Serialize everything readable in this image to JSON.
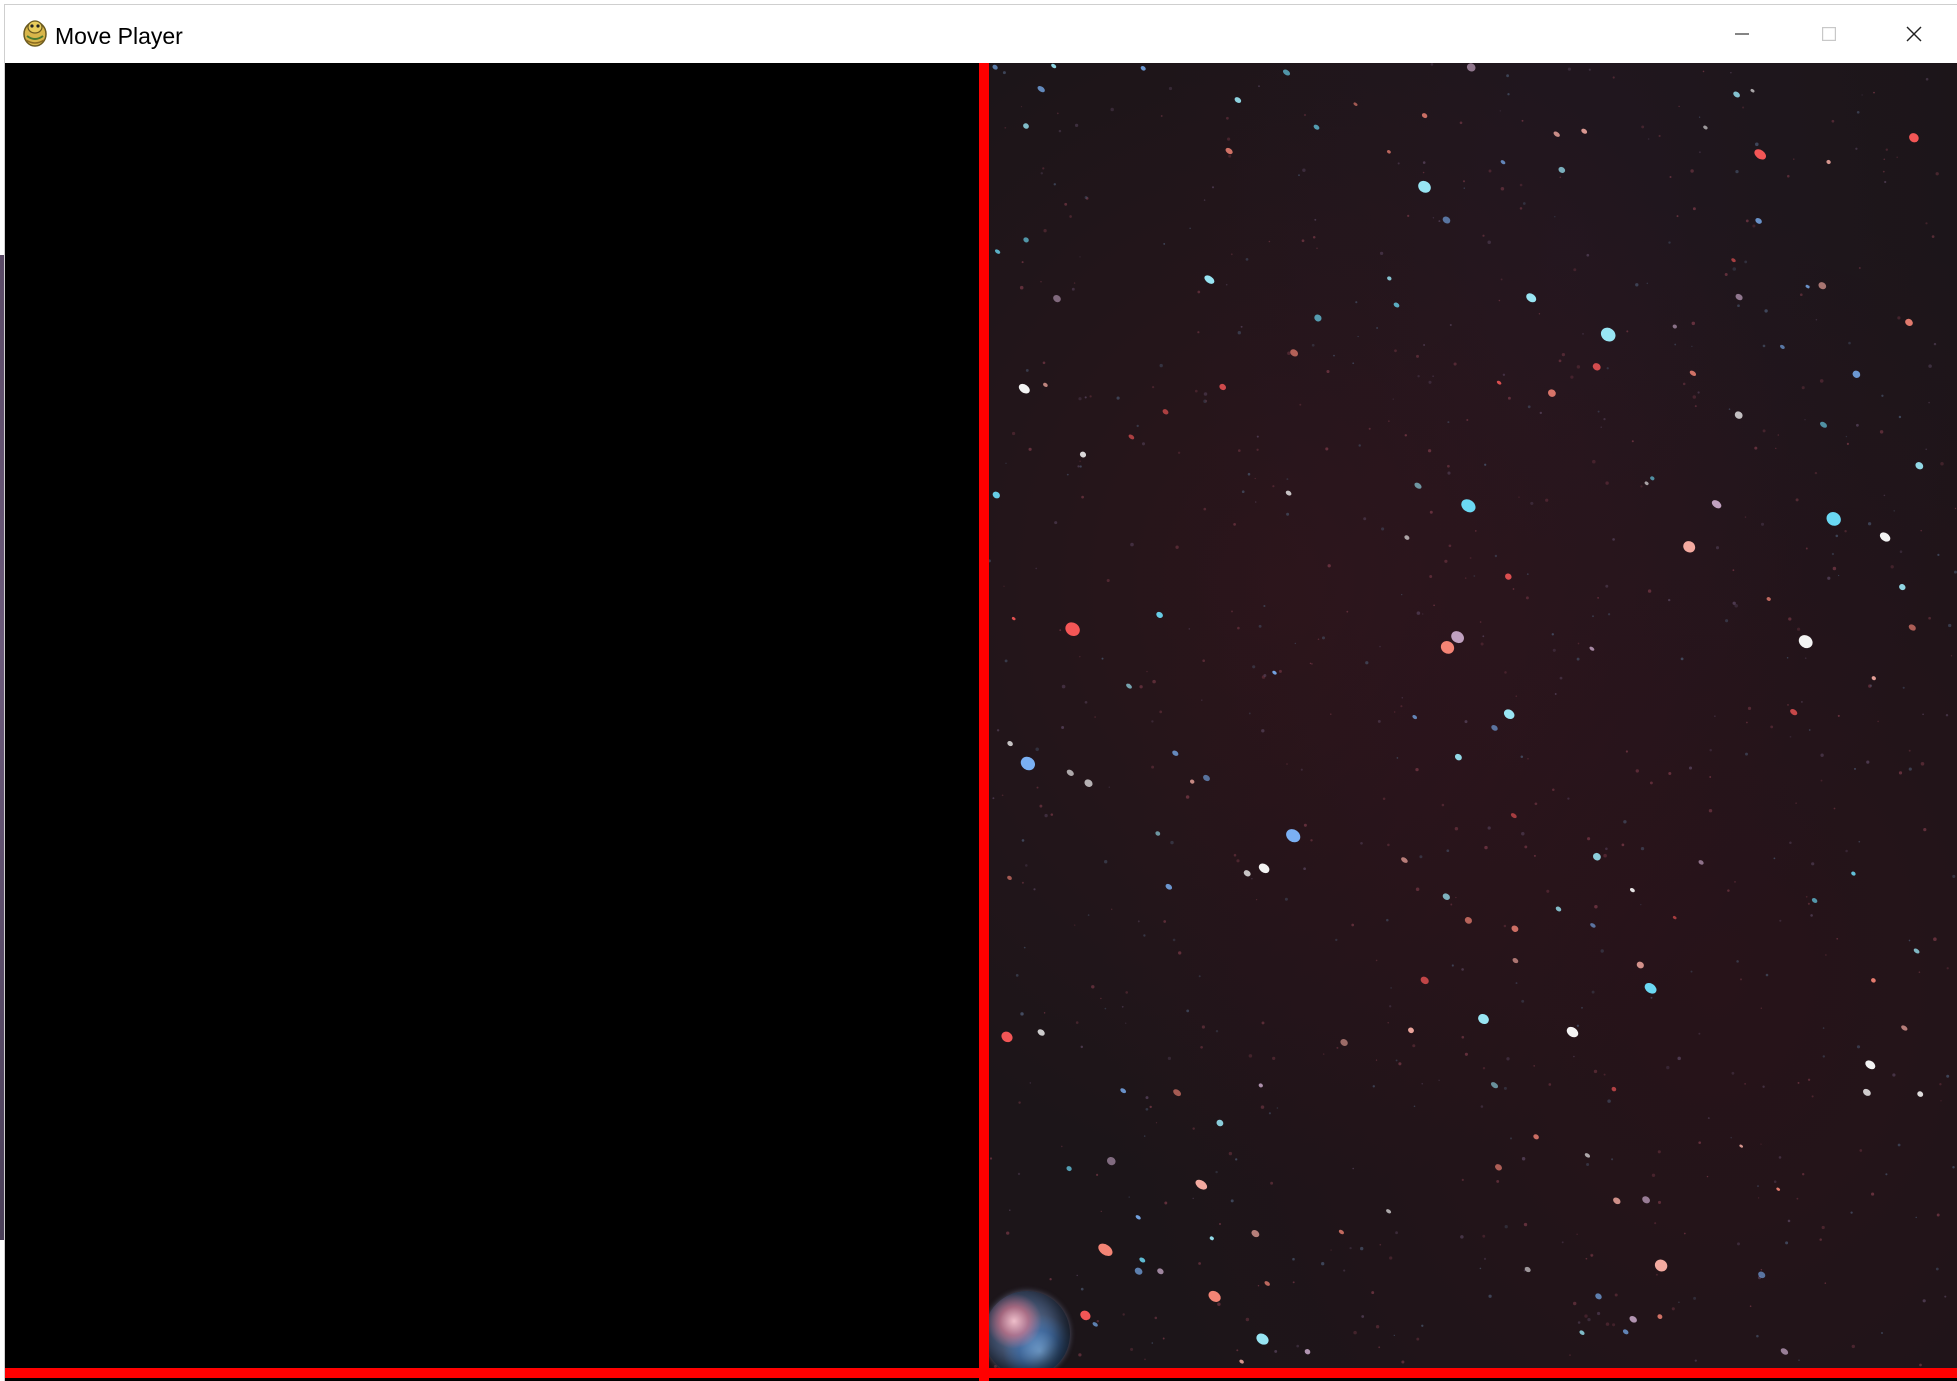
{
  "window": {
    "title": "Move Player",
    "app_icon": "pygame-snake-icon",
    "controls": {
      "minimize": "minimize-icon",
      "maximize": "maximize-icon",
      "close": "close-icon"
    }
  },
  "game": {
    "left_panel_color": "#000000",
    "border_color": "#ff0000",
    "background": "starfield",
    "player_sprite": "planet"
  }
}
